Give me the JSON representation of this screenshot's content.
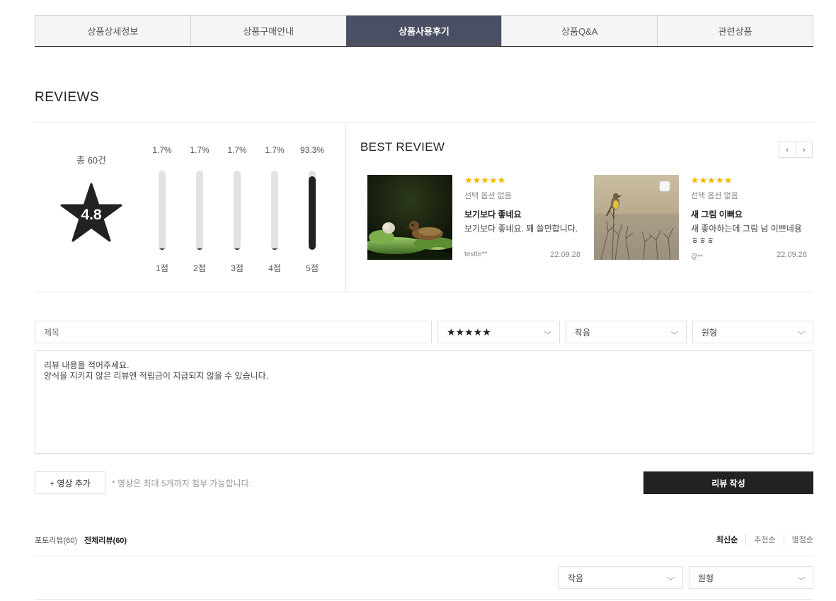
{
  "tabs": [
    {
      "label": "상품상세정보",
      "active": false
    },
    {
      "label": "상품구매안내",
      "active": false
    },
    {
      "label": "상품사용후기",
      "active": true
    },
    {
      "label": "상품Q&A",
      "active": false
    },
    {
      "label": "관련상품",
      "active": false
    }
  ],
  "reviews": {
    "title": "REVIEWS",
    "total": "총 60건",
    "score": "4.8",
    "distribution": [
      {
        "label": "1점",
        "percent_text": "1.7%",
        "percent": 1.7
      },
      {
        "label": "2점",
        "percent_text": "1.7%",
        "percent": 1.7
      },
      {
        "label": "3점",
        "percent_text": "1.7%",
        "percent": 1.7
      },
      {
        "label": "4점",
        "percent_text": "1.7%",
        "percent": 1.7
      },
      {
        "label": "5점",
        "percent_text": "93.3%",
        "percent": 93.3
      }
    ]
  },
  "best": {
    "title": "BEST REVIEW",
    "prev_icon": "‹",
    "next_icon": "›",
    "cards": [
      {
        "stars": "★★★★★",
        "option": "선택 옵션 없음",
        "title": "보기보다 좋네요",
        "text": "보기보다 좋네요. 꽤 쓸만합니다.",
        "user": "testte**",
        "date": "22.09.28",
        "image": "duckling-on-lilypad"
      },
      {
        "stars": "★★★★★",
        "option": "선택 옵션 없음",
        "title": "새 그림 이뻐요",
        "text": "새 좋아하는데 그림 넘 이쁘네용 ㅎㅎㅎ",
        "user": "강**",
        "date": "22.09.28",
        "image": "bird-on-branch"
      }
    ]
  },
  "form": {
    "title_placeholder": "제목",
    "rating_value": "★★★★★",
    "size_value": "작음",
    "shape_value": "원형",
    "content_line1": "리뷰 내용을 적어주세요.",
    "content_line2": "양식을 지키지 않은 리뷰엔 적립금이 지급되지 않을 수 있습니다.",
    "add_video": "+ 영상 추가",
    "video_note": "* 영상은 최대 5개까지 첨부 가능합니다.",
    "submit": "리뷰 작성"
  },
  "list": {
    "photo_tab": "포토리뷰(60)",
    "all_tab": "전체리뷰(60)",
    "sort": [
      "최신순",
      "추천순",
      "별점순"
    ],
    "filter_size": "작음",
    "filter_shape": "원형"
  },
  "colors": {
    "accent": "#4a4f63",
    "star": "#f5b800",
    "dark": "#222222"
  }
}
